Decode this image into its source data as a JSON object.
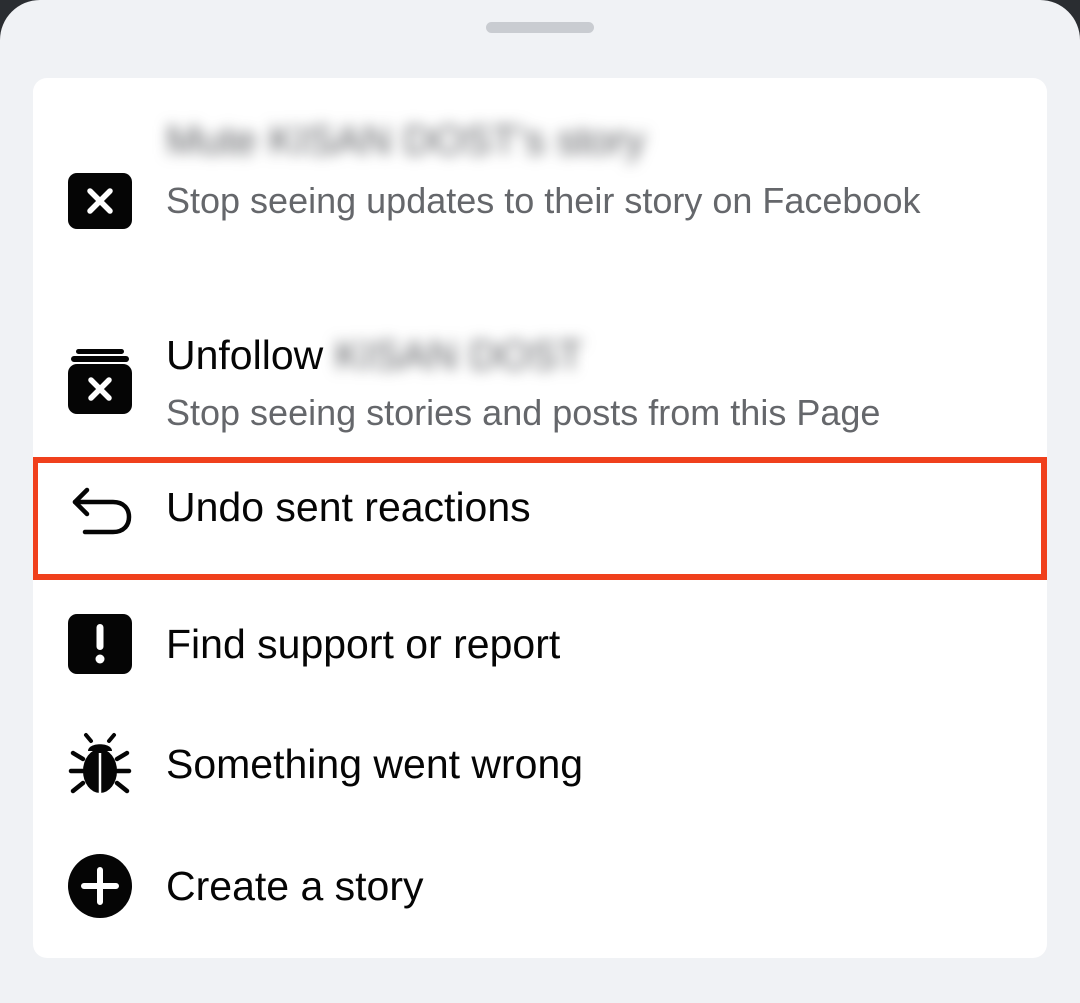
{
  "sheet": {
    "items": [
      {
        "title_name": "Mute KISAN DOST's story",
        "subtitle": "Stop seeing updates to their story on Facebook",
        "icon": "close-square-icon"
      },
      {
        "title": "Unfollow",
        "title_name": "KISAN DOST",
        "subtitle": "Stop seeing stories and posts from this Page",
        "icon": "unfollow-box-icon"
      },
      {
        "title": "Undo sent reactions",
        "icon": "undo-arrow-icon",
        "highlighted": true
      },
      {
        "title": "Find support or report",
        "icon": "exclamation-square-icon"
      },
      {
        "title": "Something went wrong",
        "icon": "bug-icon"
      },
      {
        "title": "Create a story",
        "icon": "plus-circle-icon"
      }
    ]
  },
  "colors": {
    "sheet_background": "#f0f2f5",
    "card_background": "#ffffff",
    "title_text": "#050505",
    "subtitle_text": "#65676b",
    "highlight_border": "#f0401c"
  }
}
